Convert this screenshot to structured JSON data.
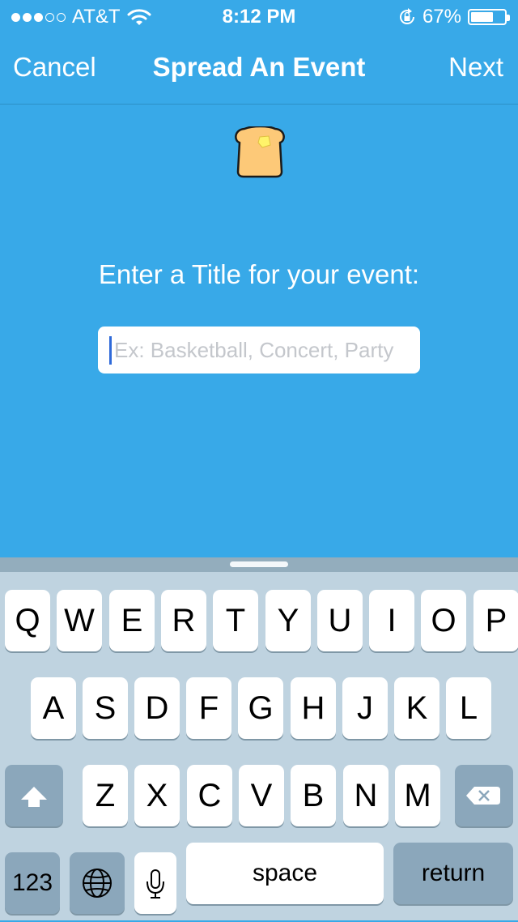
{
  "status_bar": {
    "carrier": "AT&T",
    "signal_bars_filled": 3,
    "signal_bars_total": 5,
    "time": "8:12 PM",
    "battery_percent": "67%",
    "battery_level": 0.67
  },
  "nav": {
    "cancel_label": "Cancel",
    "title": "Spread An Event",
    "next_label": "Next"
  },
  "main": {
    "icon": "toast-icon",
    "prompt": "Enter a Title for your event:",
    "title_input": {
      "value": "",
      "placeholder": "Ex: Basketball, Concert, Party"
    }
  },
  "keyboard": {
    "row1": [
      "Q",
      "W",
      "E",
      "R",
      "T",
      "Y",
      "U",
      "I",
      "O",
      "P"
    ],
    "row2": [
      "A",
      "S",
      "D",
      "F",
      "G",
      "H",
      "J",
      "K",
      "L"
    ],
    "row3": [
      "Z",
      "X",
      "C",
      "V",
      "B",
      "N",
      "M"
    ],
    "numbers_label": "123",
    "space_label": "space",
    "return_label": "return",
    "icons": {
      "shift": "shift-arrow-icon",
      "delete": "backspace-icon",
      "globe": "globe-icon",
      "mic": "microphone-icon"
    }
  },
  "colors": {
    "background": "#38a9e8",
    "keyboard": "#bfd3e0",
    "caret": "#2f6ad9"
  }
}
